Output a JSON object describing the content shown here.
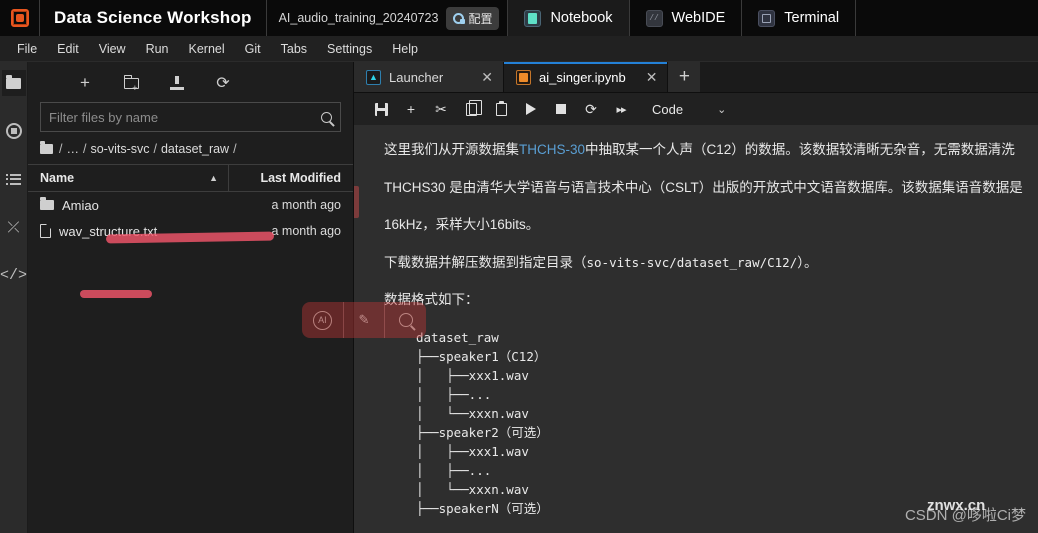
{
  "titlebar": {
    "logo_icon": "app-logo-icon",
    "app_title": "Data Science Workshop",
    "session_name": "AI_audio_training_20240723",
    "config_label": "配置",
    "tabs": [
      {
        "label": "Notebook",
        "icon": "notebook-icon",
        "active": true
      },
      {
        "label": "WebIDE",
        "icon": "webide-icon",
        "active": false
      },
      {
        "label": "Terminal",
        "icon": "terminal-icon",
        "active": false
      }
    ]
  },
  "menubar": {
    "items": [
      "File",
      "Edit",
      "View",
      "Run",
      "Kernel",
      "Git",
      "Tabs",
      "Settings",
      "Help"
    ]
  },
  "rail": {
    "items": [
      {
        "name": "file-browser",
        "icon": "folder-icon",
        "selected": true
      },
      {
        "name": "running-terminals-kernels",
        "icon": "running-circle-icon",
        "selected": false
      },
      {
        "name": "table-of-contents",
        "icon": "list-icon",
        "selected": false
      },
      {
        "name": "git-extension",
        "icon": "shuffle-icon",
        "glyph": "⤫",
        "selected": false
      },
      {
        "name": "extension-manager",
        "icon": "code-brackets-icon",
        "glyph": "</>",
        "selected": false
      }
    ]
  },
  "filebrowser": {
    "toolbar": [
      {
        "name": "new-launcher",
        "icon": "plus-icon",
        "glyph": "+"
      },
      {
        "name": "new-folder",
        "icon": "new-folder-icon"
      },
      {
        "name": "upload-files",
        "icon": "upload-icon"
      },
      {
        "name": "refresh-file-list",
        "icon": "refresh-icon",
        "glyph": "⟳"
      }
    ],
    "filter_placeholder": "Filter files by name",
    "filter_value": "",
    "breadcrumbs": [
      "/",
      "…",
      "/",
      "so-vits-svc",
      "/",
      "dataset_raw",
      "/"
    ],
    "columns": {
      "name": "Name",
      "modified": "Last Modified"
    },
    "sort_caret": "▲",
    "rows": [
      {
        "name": "Amiao",
        "type": "folder",
        "modified": "a month ago"
      },
      {
        "name": "wav_structure.txt",
        "type": "file",
        "modified": "a month ago"
      }
    ],
    "ai_popup": {
      "items": [
        {
          "name": "ai-assist-button",
          "icon": "ai-badge-icon",
          "glyph": "AI"
        },
        {
          "name": "ai-edit-button",
          "icon": "pencil-icon",
          "glyph": "✎"
        },
        {
          "name": "ai-search-button",
          "icon": "search-icon"
        }
      ]
    }
  },
  "notebook": {
    "tabs": [
      {
        "label": "Launcher",
        "icon": "launcher-icon",
        "close": "✕",
        "active": false
      },
      {
        "label": "ai_singer.ipynb",
        "icon": "notebook-file-icon",
        "close": "✕",
        "active": true
      }
    ],
    "add_tab": "+",
    "toolbar": [
      {
        "name": "save-notebook",
        "icon": "save-icon"
      },
      {
        "name": "insert-cell-below",
        "icon": "plus-icon",
        "glyph": "+"
      },
      {
        "name": "cut-cells",
        "icon": "scissors-icon",
        "glyph": "✂"
      },
      {
        "name": "copy-cells",
        "icon": "copy-icon"
      },
      {
        "name": "paste-cells",
        "icon": "paste-icon"
      },
      {
        "name": "run-cell",
        "icon": "play-icon"
      },
      {
        "name": "interrupt-kernel",
        "icon": "stop-icon"
      },
      {
        "name": "restart-kernel",
        "icon": "restart-icon",
        "glyph": "⟳"
      },
      {
        "name": "restart-and-run-all",
        "icon": "fast-forward-icon",
        "glyph": "▸▸"
      }
    ],
    "cell_type": "Code",
    "cell_type_chevron": "⌄",
    "content": {
      "para1_a": "这里我们从开源数据集",
      "para1_link": "THCHS-30",
      "para1_b": "中抽取某一个人声（C12）的数据。该数据较清晰无杂音，无需数据清洗",
      "para2": "THCHS30 是由清华大学语音与语言技术中心（CSLT）出版的开放式中文语音数据库。该数据集语音数据是",
      "para3": "16kHz，采样大小16bits。",
      "para4_a": "下载数据并解压数据到指定目录（",
      "para4_code": "so-vits-svc/dataset_raw/C12/",
      "para4_b": "）。",
      "para5": "数据格式如下：",
      "tree": "dataset_raw\n├──speaker1（C12）\n│   ├──xxx1.wav\n│   ├──...\n│   └──xxxn.wav\n├──speaker2（可选）\n│   ├──xxx1.wav\n│   ├──...\n│   └──xxxn.wav\n├──speakerN（可选）"
    },
    "watermark": "CSDN @哆啦Ci梦",
    "watermark_overlay": "znwx.cn"
  },
  "colors": {
    "accent_blue": "#2481d7",
    "link_blue": "#5a9fd4",
    "highlight_red": "#f2556a",
    "logo_orange": "#e8561f"
  }
}
